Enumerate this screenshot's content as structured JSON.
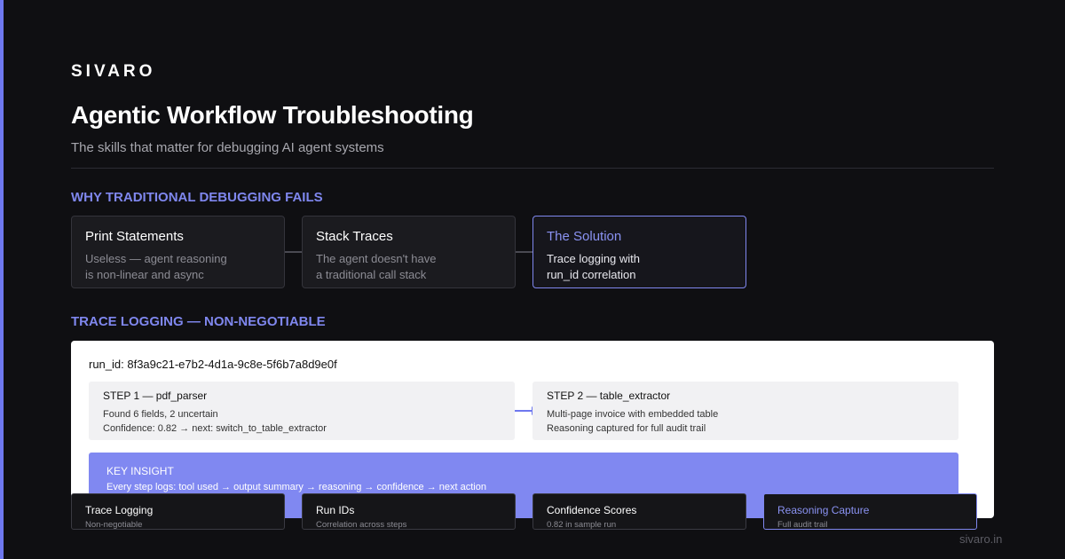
{
  "brand": "SIVARO",
  "title": "Agentic Workflow Troubleshooting",
  "subtitle": "The skills that matter for debugging AI agent systems",
  "colors": {
    "accent": "#7f87ee",
    "background": "#0f0f12",
    "insight": "#8088f1"
  },
  "section1": {
    "heading": "WHY TRADITIONAL DEBUGGING FAILS",
    "cards": [
      {
        "title": "Print Statements",
        "lines": [
          "Useless — agent reasoning",
          "is non-linear and async"
        ]
      },
      {
        "title": "Stack Traces",
        "lines": [
          "The agent doesn't have",
          "a traditional call stack"
        ]
      },
      {
        "title": "The Solution",
        "lines": [
          "Trace logging with",
          "run_id correlation"
        ]
      }
    ]
  },
  "section2": {
    "heading": "TRACE LOGGING — NON-NEGOTIABLE",
    "run_id": "run_id: 8f3a9c21-e7b2-4d1a-9c8e-5f6b7a8d9e0f",
    "steps": [
      {
        "title": "STEP 1 — pdf_parser",
        "lines": [
          "Found 6 fields, 2 uncertain",
          "Confidence: 0.82 → next: switch_to_table_extractor"
        ]
      },
      {
        "title": "STEP 2 — table_extractor",
        "lines": [
          "Multi-page invoice with embedded table",
          "Reasoning captured for full audit trail"
        ]
      }
    ],
    "insight": {
      "title": "KEY INSIGHT",
      "text": "Every step logs: tool used → output summary → reasoning → confidence → next action"
    }
  },
  "pills": [
    {
      "title": "Trace Logging",
      "sub": "Non-negotiable"
    },
    {
      "title": "Run IDs",
      "sub": "Correlation across steps"
    },
    {
      "title": "Confidence Scores",
      "sub": "0.82 in sample run"
    },
    {
      "title": "Reasoning Capture",
      "sub": "Full audit trail"
    }
  ],
  "footer": "sivaro.in"
}
